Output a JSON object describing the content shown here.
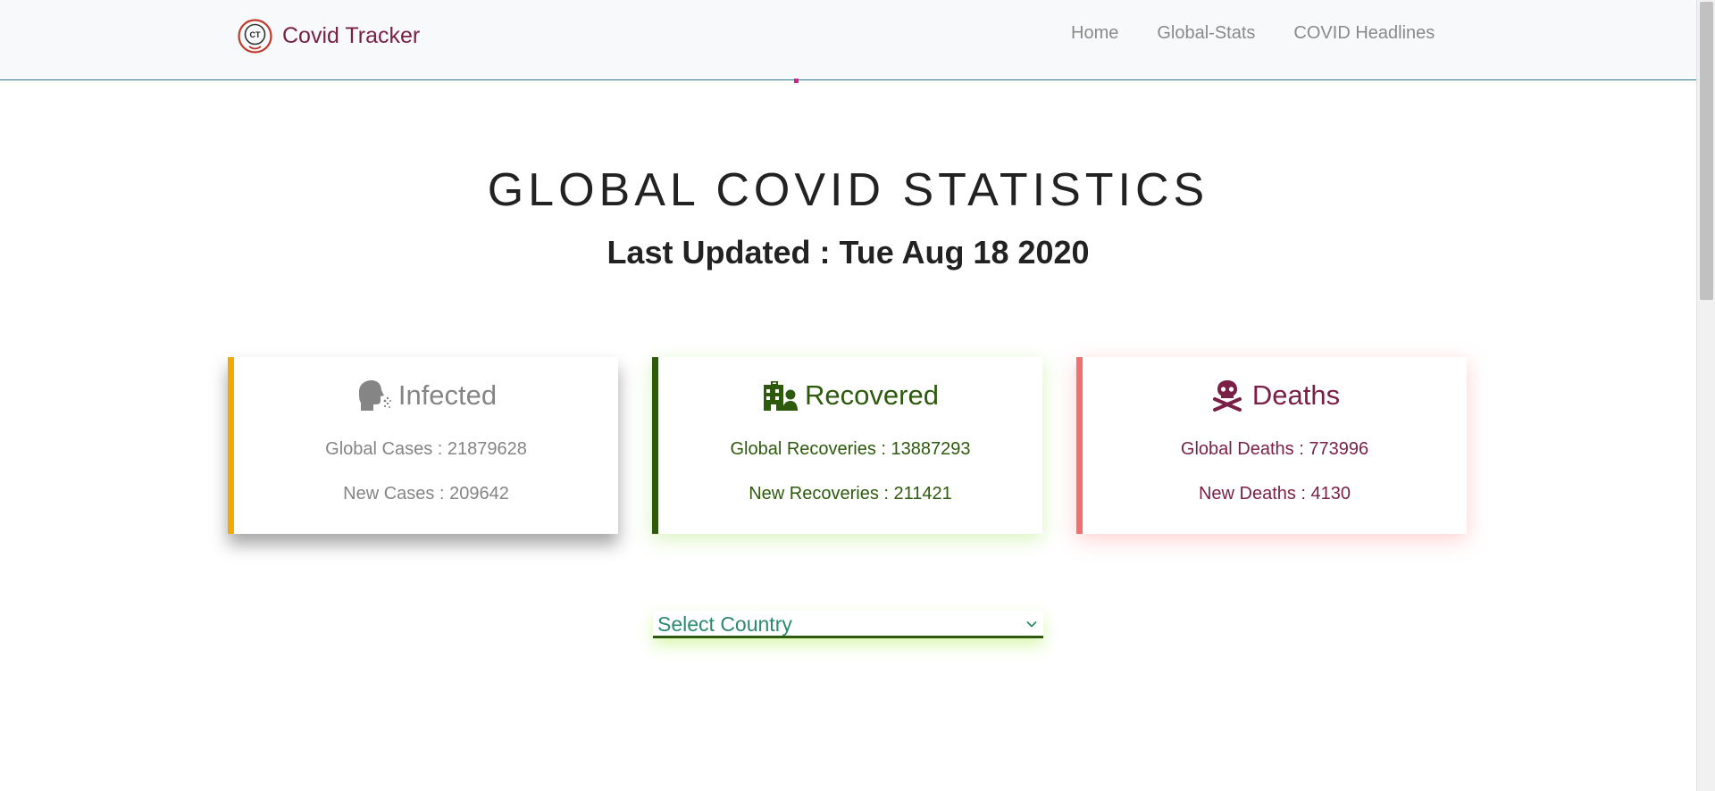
{
  "navbar": {
    "brand_mark": "CT",
    "brand_name": "Covid Tracker",
    "links": [
      "Home",
      "Global-Stats",
      "COVID Headlines"
    ]
  },
  "page": {
    "title": "GLOBAL COVID STATISTICS",
    "last_updated": "Last Updated : Tue Aug 18 2020"
  },
  "cards": {
    "infected": {
      "icon": "head-sneeze-icon",
      "heading": "Infected",
      "line1": "Global Cases : 21879628",
      "line2": "New Cases : 209642",
      "accent": "#f5a800"
    },
    "recovered": {
      "icon": "hospital-user-icon",
      "heading": "Recovered",
      "line1": "Global Recoveries : 13887293",
      "line2": "New Recoveries : 211421",
      "accent": "#2d5a0d"
    },
    "deaths": {
      "icon": "skull-crossbones-icon",
      "heading": "Deaths",
      "line1": "Global Deaths : 773996",
      "line2": "New Deaths : 4130",
      "accent": "#f07070"
    }
  },
  "country_select": {
    "selected": "Select Country"
  },
  "colors": {
    "brand": "#7a1f45",
    "nav_link": "#8a8a8a",
    "recovered_green": "#2d5a0d",
    "select_text": "#2c8a6a"
  }
}
